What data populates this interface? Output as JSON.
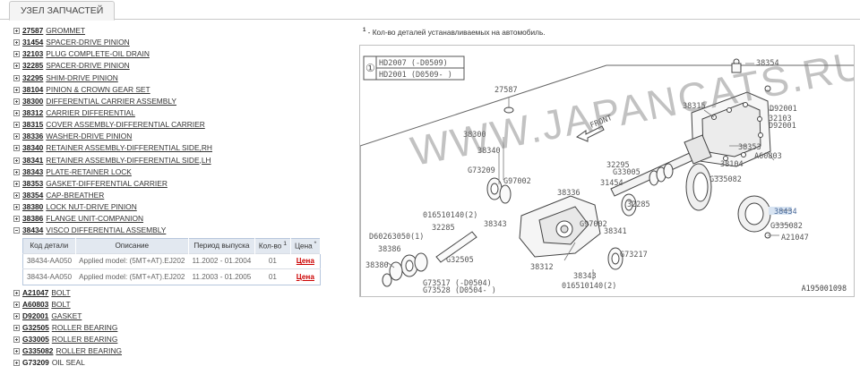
{
  "tab": {
    "label": "УЗЕЛ ЗАПЧАСТЕЙ"
  },
  "tree_before": [
    {
      "code": "27587",
      "name": "GROMMET"
    },
    {
      "code": "31454",
      "name": "SPACER-DRIVE PINION"
    },
    {
      "code": "32103",
      "name": "PLUG COMPLETE-OIL DRAIN"
    },
    {
      "code": "32285",
      "name": "SPACER-DRIVE PINION"
    },
    {
      "code": "32295",
      "name": "SHIM-DRIVE PINION"
    },
    {
      "code": "38104",
      "name": "PINION & CROWN GEAR SET"
    },
    {
      "code": "38300",
      "name": "DIFFERENTIAL CARRIER ASSEMBLY"
    },
    {
      "code": "38312",
      "name": "CARRIER DIFFERENTIAL"
    },
    {
      "code": "38315",
      "name": "COVER ASSEMBLY-DIFFERENTIAL CARRIER"
    },
    {
      "code": "38336",
      "name": "WASHER-DRIVE PINION"
    },
    {
      "code": "38340",
      "name": "RETAINER ASSEMBLY-DIFFERENTIAL SIDE,RH"
    },
    {
      "code": "38341",
      "name": "RETAINER ASSEMBLY-DIFFERENTIAL SIDE,LH"
    },
    {
      "code": "38343",
      "name": "PLATE-RETAINER LOCK"
    },
    {
      "code": "38353",
      "name": "GASKET-DIFFERENTIAL CARRIER"
    },
    {
      "code": "38354",
      "name": "CAP-BREATHER"
    },
    {
      "code": "38380",
      "name": "LOCK NUT-DRIVE PINION"
    },
    {
      "code": "38386",
      "name": "FLANGE UNIT-COMPANION"
    }
  ],
  "expanded": {
    "code": "38434",
    "name": "VISCO DIFFERENTIAL ASSEMBLY"
  },
  "parts_table": {
    "headers": [
      "Код детали",
      "Описание",
      "Период выпуска",
      "Кол-во",
      "Цена"
    ],
    "qty_sup": "1",
    "price_sup": "*",
    "rows": [
      {
        "code": "38434-AA050",
        "desc": "Applied model: (5MT+AT).EJ202",
        "period": "11.2002 - 01.2004",
        "qty": "01",
        "price": "Цена"
      },
      {
        "code": "38434-AA050",
        "desc": "Applied model: (5MT+AT).EJ202",
        "period": "11.2003 - 01.2005",
        "qty": "01",
        "price": "Цена"
      }
    ]
  },
  "tree_after": [
    {
      "code": "A21047",
      "name": "BOLT"
    },
    {
      "code": "A60803",
      "name": "BOLT"
    },
    {
      "code": "D92001",
      "name": "GASKET"
    },
    {
      "code": "G32505",
      "name": "ROLLER BEARING"
    },
    {
      "code": "G33005",
      "name": "ROLLER BEARING"
    },
    {
      "code": "G335082",
      "name": "ROLLER BEARING"
    },
    {
      "code": "G73209",
      "name": "OIL SEAL"
    }
  ],
  "note": {
    "sup": "1",
    "text": "- Кол-во деталей устанавливаемых на автомобиль."
  },
  "diagram": {
    "watermark": "WWW.JAPANCATS.RU",
    "ref": "A195001098",
    "legend_num": "①",
    "legend": [
      "HD2007 (-D0509)",
      "HD2001 (D0509- )"
    ],
    "front": "FRONT",
    "labels": [
      {
        "t": "38354"
      },
      {
        "t": "27587"
      },
      {
        "t": "38315"
      },
      {
        "t": "D92001"
      },
      {
        "t": "32103"
      },
      {
        "t": "D92001"
      },
      {
        "t": "38300"
      },
      {
        "t": "38340"
      },
      {
        "t": "38353"
      },
      {
        "t": "A60803"
      },
      {
        "t": "38104"
      },
      {
        "t": "G73209"
      },
      {
        "t": "G97002"
      },
      {
        "t": "G33005"
      },
      {
        "t": "32295"
      },
      {
        "t": "G335082"
      },
      {
        "t": "31454"
      },
      {
        "t": "38336"
      },
      {
        "t": "32285"
      },
      {
        "t": "38434"
      },
      {
        "t": "G335082"
      },
      {
        "t": "A21047"
      },
      {
        "t": "016510140(2)"
      },
      {
        "t": "38343"
      },
      {
        "t": "G97002"
      },
      {
        "t": "32285"
      },
      {
        "t": "38341"
      },
      {
        "t": "D60263050(1)"
      },
      {
        "t": "38386"
      },
      {
        "t": "G32505"
      },
      {
        "t": "G73217"
      },
      {
        "t": "38380"
      },
      {
        "t": "38312"
      },
      {
        "t": "38343"
      },
      {
        "t": "G73517 (-D0504)"
      },
      {
        "t": "G73528 (D0504- )"
      },
      {
        "t": "016510140(2)"
      }
    ],
    "colors": {
      "line": "#555555",
      "highlight": "#d8e4f2"
    }
  }
}
